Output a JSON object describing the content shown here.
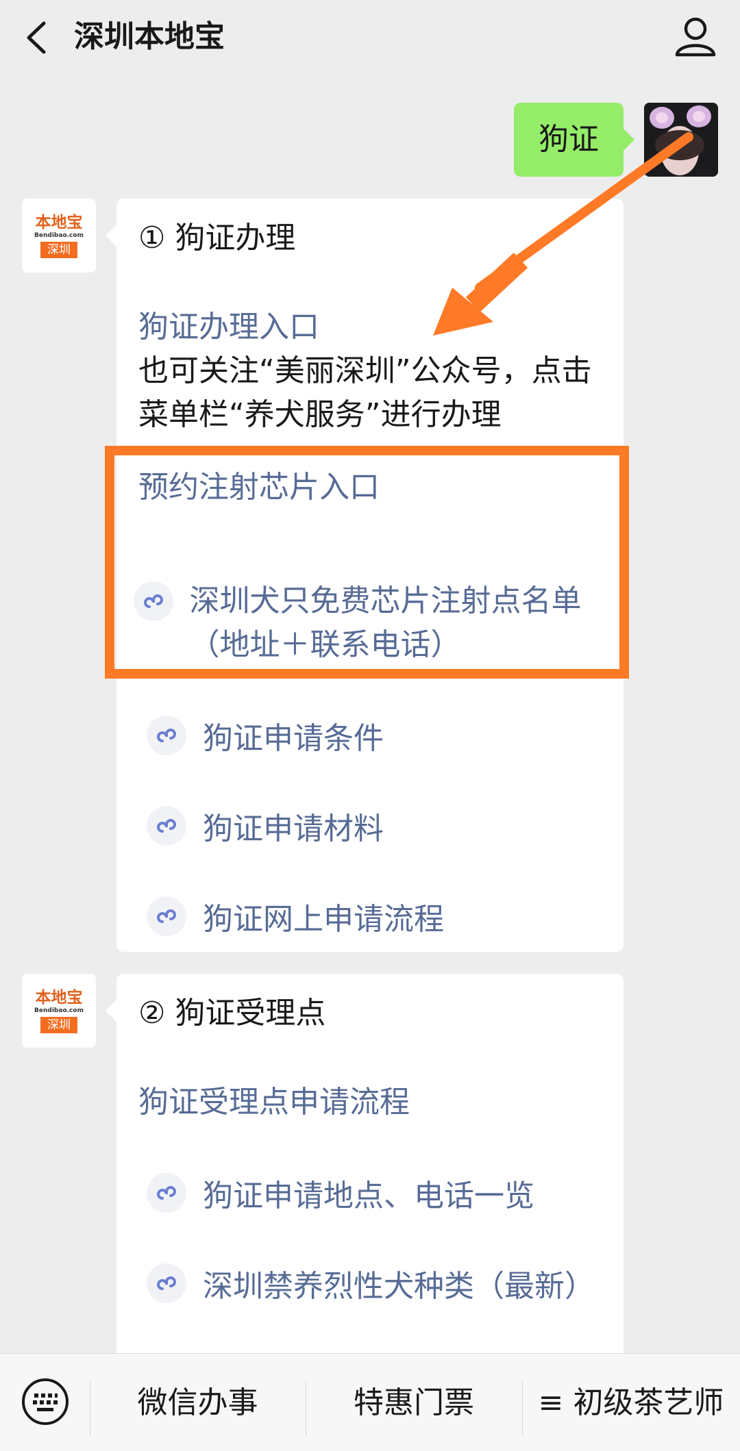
{
  "header": {
    "title": "深圳本地宝"
  },
  "conversation": {
    "user_message": "狗证",
    "bot_avatar": {
      "brand": "本地宝",
      "domain": "Bendibao.com",
      "city": "深圳"
    },
    "message1": {
      "heading": "① 狗证办理",
      "link_entry": "狗证办理入口",
      "note": "也可关注“美丽深圳”公众号，点击菜单栏“养犬服务”进行办理",
      "link_appointment": "预约注射芯片入口",
      "mini_links": [
        "深圳犬只免费芯片注射点名单（地址＋联系电话）",
        "狗证申请条件",
        "狗证申请材料",
        "狗证网上申请流程"
      ]
    },
    "message2": {
      "heading": "② 狗证受理点",
      "link_process": "狗证受理点申请流程",
      "mini_links": [
        "狗证申请地点、电话一览",
        "深圳禁养烈性犬种类（最新）"
      ]
    }
  },
  "bottom_menu": {
    "items": [
      "微信办事",
      "特惠门票",
      "初级茶艺师"
    ],
    "third_prefix": "≡"
  },
  "colors": {
    "link": "#576b95",
    "user_bubble": "#95ec69",
    "highlight": "#ff7a26"
  }
}
